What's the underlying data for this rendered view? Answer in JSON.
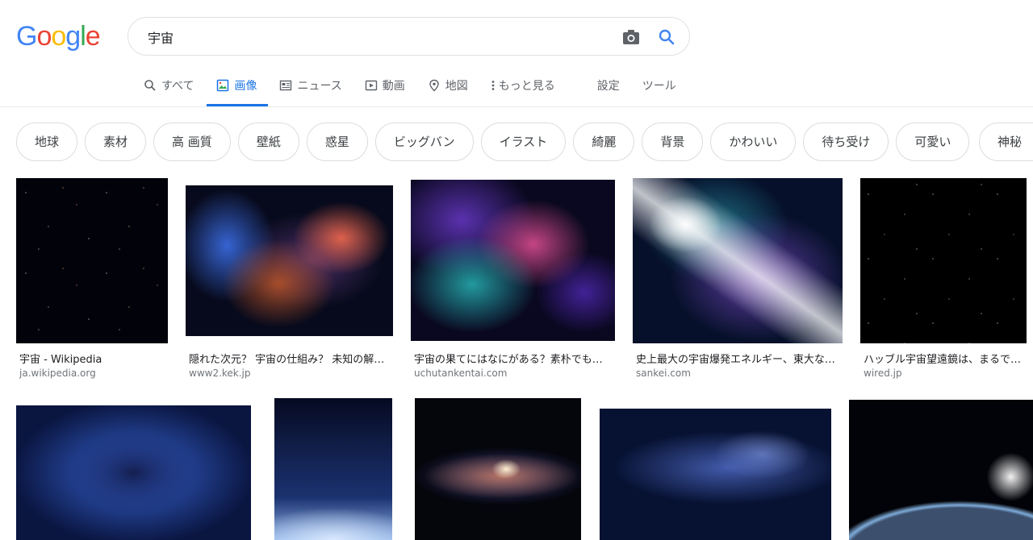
{
  "search": {
    "query": "宇宙"
  },
  "tabs": [
    {
      "label": "すべて",
      "icon": "search-icon"
    },
    {
      "label": "画像",
      "icon": "image-icon",
      "active": true
    },
    {
      "label": "ニュース",
      "icon": "news-icon"
    },
    {
      "label": "動画",
      "icon": "video-icon"
    },
    {
      "label": "地図",
      "icon": "map-pin-icon"
    },
    {
      "label": "もっと見る",
      "icon": "more-vert-icon"
    }
  ],
  "tools": {
    "settings": "設定",
    "tools": "ツール"
  },
  "chips": [
    "地球",
    "素材",
    "高 画質",
    "壁紙",
    "惑星",
    "ビッグバン",
    "イラスト",
    "綺麗",
    "背景",
    "かわいい",
    "待ち受け",
    "可愛い",
    "神秘"
  ],
  "results": [
    {
      "title": "宇宙 - Wikipedia",
      "source": "ja.wikipedia.org"
    },
    {
      "title": "隠れた次元？ 宇宙の仕組み？ 未知の解明へ",
      "source": "www2.kek.jp"
    },
    {
      "title": "宇宙の果てにはなにがある？素朴でも奥深い疑問",
      "source": "uchutankentai.com"
    },
    {
      "title": "史上最大の宇宙爆発エネルギー、東大などが観測",
      "source": "sankei.com"
    },
    {
      "title": "ハッブル宇宙望遠鏡は、まるで宇宙の窓",
      "source": "wired.jp"
    }
  ],
  "colors": {
    "accent": "#1a73e8",
    "text_secondary": "#70757a",
    "chip_border": "#dadce0"
  }
}
